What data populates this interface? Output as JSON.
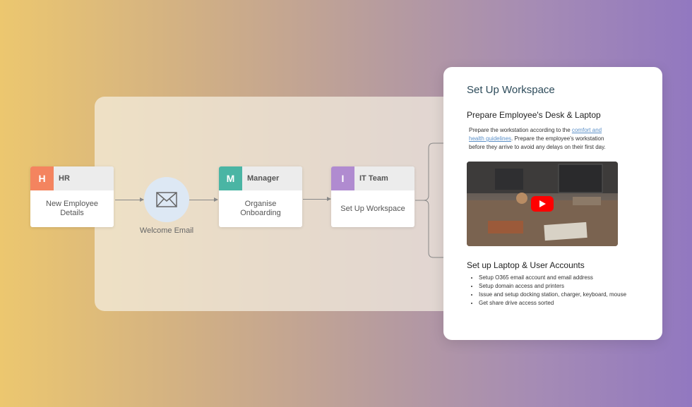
{
  "workflow": {
    "nodes": [
      {
        "initial": "H",
        "title": "HR",
        "body": "New Employee Details",
        "color": "#f4845f"
      },
      {
        "initial": "M",
        "title": "Manager",
        "body": "Organise Onboarding",
        "color": "#4ab5a4"
      },
      {
        "initial": "I",
        "title": "IT Team",
        "body": "Set Up Workspace",
        "color": "#b08bd0"
      }
    ],
    "email_node": {
      "label": "Welcome Email",
      "icon": "envelope-icon"
    }
  },
  "detail": {
    "title": "Set Up Workspace",
    "section1": {
      "heading": "Prepare Employee's Desk & Laptop",
      "text_before": "Prepare the workstation according to the ",
      "link": "comfort and health guidelines",
      "text_after": ". Prepare the employee's workstation before they arrive to avoid any delays on their first day.",
      "video_icon": "play-icon"
    },
    "section2": {
      "heading": "Set up Laptop & User Accounts",
      "items": [
        "Setup O365 email account and email address",
        "Setup domain access and printers",
        "Issue and setup docking station, charger, keyboard, mouse",
        "Get share drive access sorted"
      ]
    }
  }
}
